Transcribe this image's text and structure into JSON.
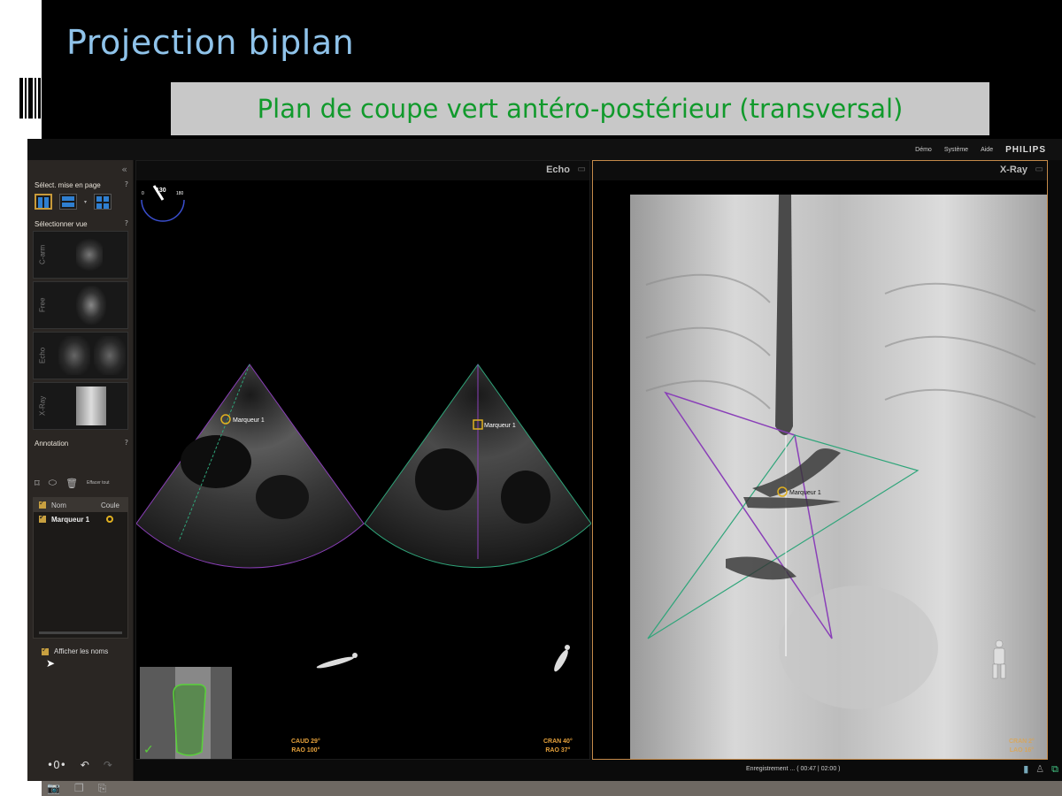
{
  "slide": {
    "title": "Projection biplan",
    "subtitle": "Plan de coupe vert antéro-postérieur (transversal)"
  },
  "app": {
    "menu": [
      "Démo",
      "Système",
      "Aide"
    ],
    "brand": "PHILIPS"
  },
  "sidebar": {
    "layout_label": "Sélect. mise en page",
    "view_label": "Sélectionner vue",
    "views": [
      "C-arm",
      "Free",
      "Echo",
      "X-Ray"
    ],
    "annotation_label": "Annotation",
    "clear_all": "Effacer tout",
    "table": {
      "columns": [
        "Nom",
        "Coule"
      ],
      "rows": [
        {
          "name": "Marqueur 1"
        }
      ]
    },
    "show_names": "Afficher les noms",
    "help": "?"
  },
  "echo": {
    "title": "Echo",
    "dial": {
      "min": "0",
      "value": "130",
      "max": "180"
    },
    "marker_left": "Marqueur 1",
    "marker_right": "Marqueur 1",
    "angle_left": [
      "CAUD 29°",
      "RAO 100°"
    ],
    "angle_right": [
      "CRAN 40°",
      "RAO 37°"
    ]
  },
  "xray": {
    "title": "X-Ray",
    "marker": "Marqueur 1",
    "angle": [
      "CRAN 2°",
      "LAO 16°"
    ]
  },
  "status": {
    "text": "Enregistrement ... ( 00:47 | 02:00 )"
  },
  "colors": {
    "title": "#8fc3ea",
    "subtitle": "#119a2c",
    "accent": "#e6a23c",
    "purple_plane": "#8a3fb8",
    "green_plane": "#2fa57a",
    "marker": "#e0b020"
  }
}
